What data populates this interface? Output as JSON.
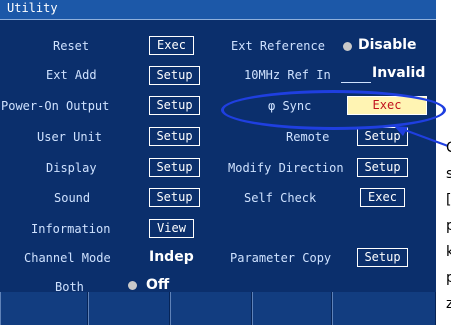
{
  "window": {
    "title": "Utility"
  },
  "left": [
    {
      "label": "Reset",
      "button": "Exec"
    },
    {
      "label": "Ext Add",
      "button": "Setup"
    },
    {
      "label": "Power-On Output",
      "button": "Setup"
    },
    {
      "label": "User Unit",
      "button": "Setup"
    },
    {
      "label": "Display",
      "button": "Setup"
    },
    {
      "label": "Sound",
      "button": "Setup"
    },
    {
      "label": "Information",
      "button": "View"
    },
    {
      "label": "Channel Mode",
      "value": "Indep"
    },
    {
      "label": "Both",
      "value": "Off",
      "indicator_color": "#c9c9c9"
    }
  ],
  "right": {
    "ext_reference": {
      "label": "Ext Reference",
      "value": "Disable",
      "indicator_color": "#c9c9c9"
    },
    "ref_in": {
      "label": "10MHz Ref In",
      "value": "Invalid"
    },
    "phase_sync": {
      "label": "φ Sync",
      "button": "Exec",
      "highlight_bg": "#fff4b3",
      "highlight_text": "#c1121f"
    },
    "remote": {
      "label": "Remote",
      "button": "Setup"
    },
    "modify_direction": {
      "label": "Modify Direction",
      "button": "Setup"
    },
    "self_check": {
      "label": "Self Check",
      "button": "Exec"
    },
    "parameter_copy": {
      "label": "Parameter Copy",
      "button": "Setup"
    }
  },
  "annotation": {
    "oval_color": "#1f3fe0",
    "callout_letters": [
      "C",
      "s",
      "[",
      "p",
      "k",
      "p",
      "z"
    ]
  },
  "colors": {
    "screen_bg": "#0b2f6c",
    "title_bg": "#1c58a8",
    "label_text": "#cfe2ff"
  }
}
